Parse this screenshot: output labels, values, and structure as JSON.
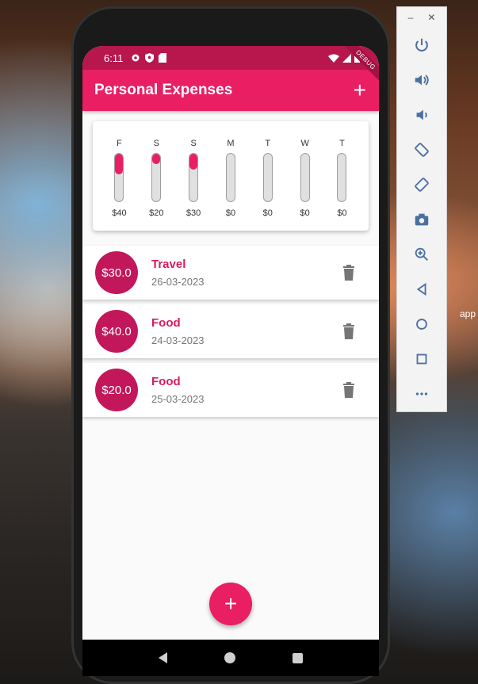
{
  "desktop": {
    "label": "app"
  },
  "status_bar": {
    "time": "6:11",
    "debug_label": "DEBUG"
  },
  "app_bar": {
    "title": "Personal Expenses",
    "add_label": "+"
  },
  "chart_data": {
    "type": "bar",
    "categories": [
      "F",
      "S",
      "S",
      "M",
      "T",
      "W",
      "T"
    ],
    "value_labels": [
      "$40",
      "$20",
      "$30",
      "$0",
      "$0",
      "$0",
      "$0"
    ],
    "values": [
      40,
      20,
      30,
      0,
      0,
      0,
      0
    ],
    "share_of_total": [
      0.44,
      0.22,
      0.33,
      0,
      0,
      0,
      0
    ]
  },
  "transactions": [
    {
      "amount": "$30.0",
      "title": "Travel",
      "date": "26-03-2023"
    },
    {
      "amount": "$40.0",
      "title": "Food",
      "date": "24-03-2023"
    },
    {
      "amount": "$20.0",
      "title": "Food",
      "date": "25-03-2023"
    }
  ],
  "fab": {
    "label": "+"
  },
  "colors": {
    "primary": "#e91e63",
    "avatar": "#c2185b",
    "status_bar": "#b8174d"
  },
  "emulator_toolbar": {
    "items": [
      "power-icon",
      "volume-up-icon",
      "volume-down-icon",
      "rotate-left-icon",
      "rotate-right-icon",
      "camera-icon",
      "zoom-in-icon",
      "back-icon",
      "home-icon",
      "overview-icon",
      "more-icon"
    ]
  }
}
